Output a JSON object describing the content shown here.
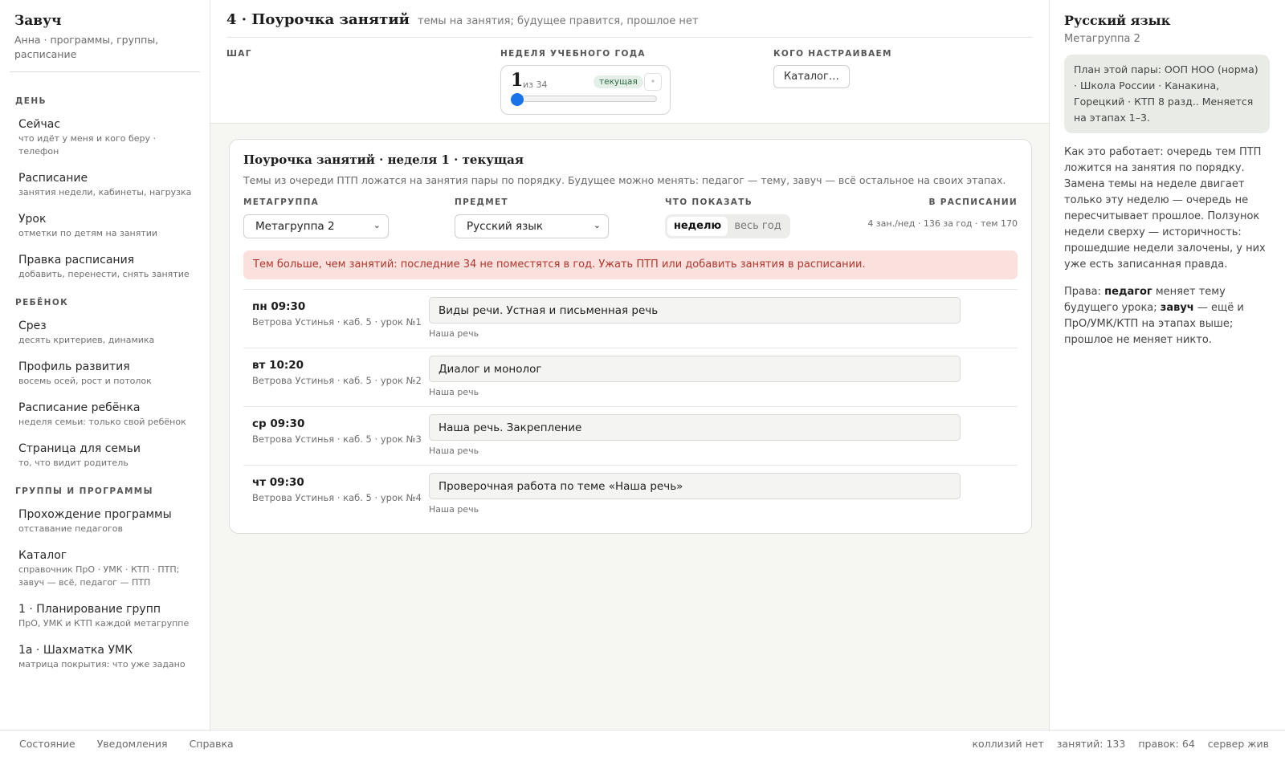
{
  "sidebar": {
    "title": "Завуч",
    "subtitle": "Анна · программы, группы, расписание",
    "sections": [
      {
        "title": "День",
        "items": [
          {
            "label": "Сейчас",
            "desc": "что идёт у меня и кого беру · телефон"
          },
          {
            "label": "Расписание",
            "desc": "занятия недели, кабинеты, нагрузка"
          },
          {
            "label": "Урок",
            "desc": "отметки по детям на занятии"
          },
          {
            "label": "Правка расписания",
            "desc": "добавить, перенести, снять занятие"
          }
        ]
      },
      {
        "title": "Ребёнок",
        "items": [
          {
            "label": "Срез",
            "desc": "десять критериев, динамика"
          },
          {
            "label": "Профиль развития",
            "desc": "восемь осей, рост и потолок"
          },
          {
            "label": "Расписание ребёнка",
            "desc": "неделя семьи: только свой ребёнок"
          },
          {
            "label": "Страница для семьи",
            "desc": "то, что видит родитель"
          }
        ]
      },
      {
        "title": "Группы и программы",
        "items": [
          {
            "label": "Прохождение программы",
            "desc": "отставание педагогов"
          },
          {
            "label": "Каталог",
            "desc": "справочник ПрО · УМК · КТП · ПТП; завуч — всё, педагог — ПТП"
          },
          {
            "label": "1 · Планирование групп",
            "desc": "ПрО, УМК и КТП каждой метагруппе"
          },
          {
            "label": "1а · Шахматка УМК",
            "desc": "матрица покрытия: что уже задано"
          }
        ]
      }
    ]
  },
  "header": {
    "title": "4 · Поурочка занятий",
    "subtitle": "темы на занятия; будущее правится, прошлое нет",
    "step_label": "Шаг",
    "week_label": "Неделя учебного года",
    "week_number": "1",
    "week_of": "из 34",
    "week_badge": "текущая",
    "week_dot": "•",
    "week_progress": 0,
    "who_label": "Кого настраиваем",
    "catalog_button": "Каталог…"
  },
  "card": {
    "title": "Поурочка занятий · неделя 1 · текущая",
    "subtitle": "Темы из очереди ПТП ложатся на занятия пары по порядку. Будущее можно менять: педагог — тему, завуч — всё остальное на своих этапах.",
    "metagroup_label": "Метагруппа",
    "metagroup_value": "Метагруппа 2",
    "subject_label": "Предмет",
    "subject_value": "Русский язык",
    "show_label": "Что показать",
    "show_options": [
      "неделю",
      "весь год"
    ],
    "show_selected": "неделю",
    "schedule_label": "В расписании",
    "schedule_info": "4 зан./нед · 136 за год · тем 170",
    "alert": "Тем больше, чем занятий: последние 34 не поместятся в год. Ужать ПТП или добавить занятия в расписании.",
    "lessons": [
      {
        "time": "пн 09:30",
        "meta": "Ветрова Устинья · каб. 5 · урок №1",
        "topic": "Виды речи. Устная и письменная речь",
        "section": "Наша речь"
      },
      {
        "time": "вт 10:20",
        "meta": "Ветрова Устинья · каб. 5 · урок №2",
        "topic": "Диалог и монолог",
        "section": "Наша речь"
      },
      {
        "time": "ср 09:30",
        "meta": "Ветрова Устинья · каб. 5 · урок №3",
        "topic": "Наша речь. Закрепление",
        "section": "Наша речь"
      },
      {
        "time": "чт 09:30",
        "meta": "Ветрова Устинья · каб. 5 · урок №4",
        "topic": "Проверочная работа по теме «Наша речь»",
        "section": "Наша речь"
      }
    ]
  },
  "right_panel": {
    "title": "Русский язык",
    "subtitle": "Метагруппа 2",
    "plan": "План этой пары: ООП НОО (норма) · Школа России · Канакина, Горецкий · КТП 8 разд.. Меняется на этапах 1–3.",
    "how_it_works": "Как это работает: очередь тем ПТП ложится на занятия по порядку. Замена темы на неделе двигает только эту неделю — очередь не пересчитывает прошлое. Ползунок недели сверху — историчность: прошедшие недели залочены, у них уже есть записанная правда.",
    "rights_prefix": "Права: ",
    "rights_teacher": "педагог",
    "rights_mid1": " меняет тему будущего урока; ",
    "rights_head": "завуч",
    "rights_suffix": " — ещё и ПрО/УМК/КТП на этапах выше; прошлое не меняет никто."
  },
  "footer": {
    "left": [
      "Состояние",
      "Уведомления",
      "Справка"
    ],
    "right": [
      "коллизий нет",
      "занятий: 133",
      "правок: 64",
      "сервер жив"
    ]
  },
  "colors": {
    "accent": "#1a73e8",
    "alert_bg": "#fbe1de",
    "alert_text": "#b0362d",
    "badge_bg": "#e3efe7",
    "badge_text": "#2e6b47"
  }
}
